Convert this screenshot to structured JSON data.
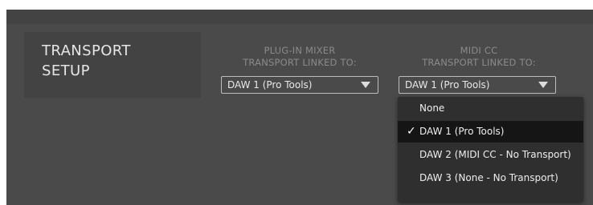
{
  "section": {
    "title_line1": "TRANSPORT",
    "title_line2": "SETUP"
  },
  "plugin_mixer": {
    "label_line1": "PLUG-IN MIXER",
    "label_line2": "TRANSPORT LINKED TO:",
    "selected_value": "DAW 1 (Pro Tools)"
  },
  "midi_cc": {
    "label_line1": "MIDI CC",
    "label_line2": "TRANSPORT LINKED TO:",
    "selected_value": "DAW 1 (Pro Tools)"
  },
  "dropdown_menu": {
    "items": [
      {
        "label": "None",
        "selected": false
      },
      {
        "label": "DAW 1 (Pro Tools)",
        "selected": true
      },
      {
        "label": "DAW 2 (MIDI CC - No Transport)",
        "selected": false
      },
      {
        "label": "DAW 3 (None - No Transport)",
        "selected": false
      }
    ],
    "check_glyph": "✓",
    "check_icon": "checkmark-icon"
  },
  "colors": {
    "panel_bg": "#4a4a4a",
    "section_bg": "#434343",
    "menu_bg": "#2f2f2f",
    "menu_selected_bg": "#151515",
    "label_gray": "#8a8a8a",
    "text_light": "#e8e8e8"
  }
}
